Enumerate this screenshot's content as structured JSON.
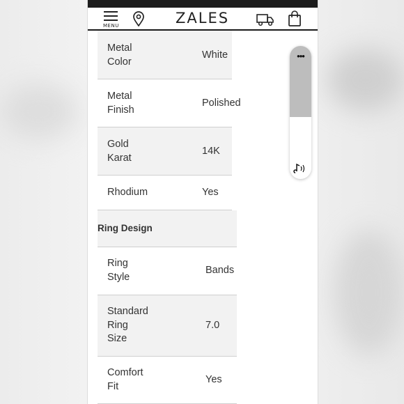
{
  "header": {
    "menu_label": "MENU",
    "logo_text": "ZALES"
  },
  "specs": {
    "rows_top": [
      {
        "label_lines": [
          "Metal",
          "Color"
        ],
        "value": "White"
      },
      {
        "label_lines": [
          "Metal",
          "Finish"
        ],
        "value": "Polished"
      },
      {
        "label_lines": [
          "Gold",
          "Karat"
        ],
        "value": "14K"
      },
      {
        "label_lines": [
          "Rhodium"
        ],
        "value": "Yes"
      }
    ],
    "section_title": "Ring Design",
    "rows_bottom": [
      {
        "label_lines": [
          "Ring",
          "Style"
        ],
        "value": "Bands"
      },
      {
        "label_lines": [
          "Standard",
          "Ring",
          "Size"
        ],
        "value": "7.0"
      },
      {
        "label_lines": [
          "Comfort",
          "Fit"
        ],
        "value": "Yes"
      }
    ]
  },
  "widget": {
    "more_glyph": "•••"
  }
}
